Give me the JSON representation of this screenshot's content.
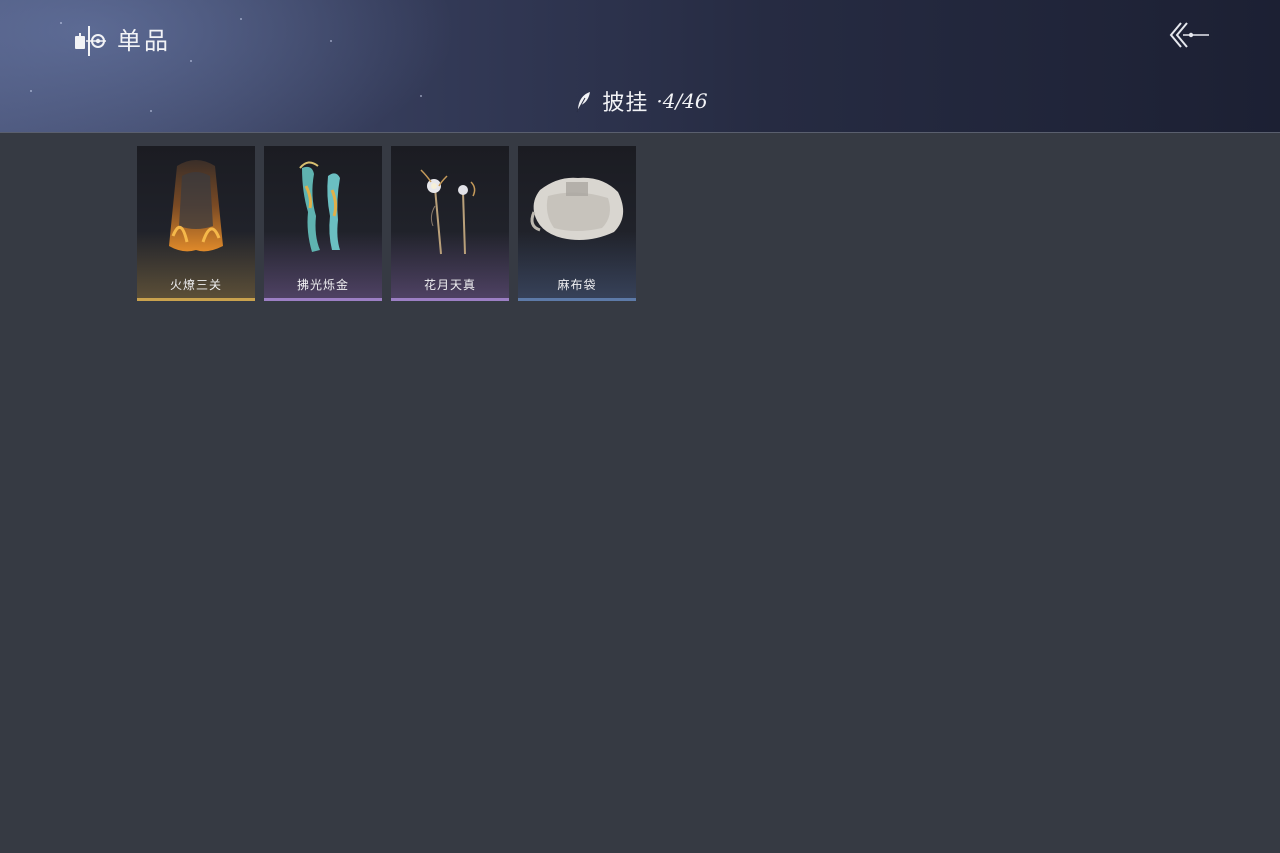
{
  "header": {
    "title": "单品",
    "title_icon": "wardrobe-icon",
    "back_icon": "double-chevron-back-icon",
    "category_icon": "feather-icon",
    "category": "披挂",
    "count": "·4/46"
  },
  "items": [
    {
      "name": "火燎三关",
      "icon": "flame-veil-icon",
      "rarity_color": "#c9a24e"
    },
    {
      "name": "拂光烁金",
      "icon": "ribbon-scarves-icon",
      "rarity_color": "#9c7fc4"
    },
    {
      "name": "花月天真",
      "icon": "flower-hairpins-icon",
      "rarity_color": "#9c7fc4"
    },
    {
      "name": "麻布袋",
      "icon": "cloth-sack-icon",
      "rarity_color": "#5d7aa8"
    }
  ],
  "colors": {
    "background": "#363a43",
    "header_dark": "#1c2033",
    "text": "#f2f3f6"
  }
}
